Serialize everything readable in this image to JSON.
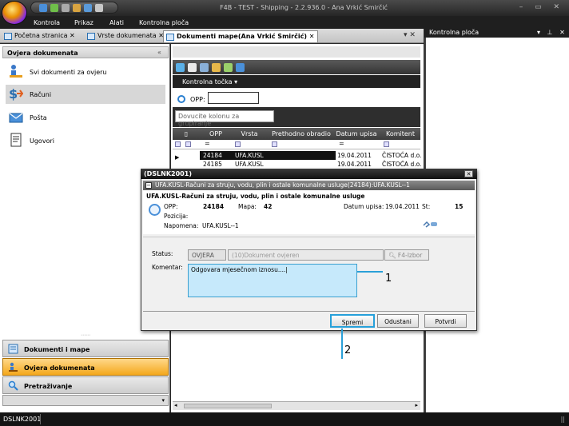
{
  "window": {
    "title": "F4B - TEST - Shipping - 2.2.936.0 - Ana  Vrkić Smirčić",
    "controls": "– ▭ ✕"
  },
  "menu": [
    "Kontrola",
    "Prikaz",
    "Alati",
    "Kontrolna ploča"
  ],
  "tabs": [
    {
      "label": "Početna stranica",
      "close": "✕"
    },
    {
      "label": "Vrste dokumenata",
      "close": "✕"
    },
    {
      "label": "Dokumenti mape(Ana Vrkić Smirčić)",
      "close": "✕"
    }
  ],
  "tab_controls": "▾ ✕",
  "right_panel": {
    "title": "Kontrolna ploča",
    "controls": "▾ ⊥ ✕"
  },
  "left_panel": {
    "title": "Ovjera dokumenata",
    "collapse": "«",
    "items": [
      {
        "label": "Svi dokumenti za ovjeru",
        "icon": "person-check-icon"
      },
      {
        "label": "Računi",
        "icon": "invoice-icon"
      },
      {
        "label": "Pošta",
        "icon": "mail-icon"
      },
      {
        "label": "Ugovori",
        "icon": "contract-icon"
      }
    ],
    "grip": "⋯⋯",
    "nav_buttons": [
      {
        "label": "Dokumenti i mape",
        "icon": "documents-icon"
      },
      {
        "label": "Ovjera dokumenata",
        "icon": "approval-icon"
      },
      {
        "label": "Pretraživanje",
        "icon": "search-icon"
      }
    ],
    "footer_arrow": "▾"
  },
  "document": {
    "kontrolna_tocka": "Kontrolna točka ▾",
    "opp_label": "OPP:",
    "opp_value": "",
    "group_hint": "Dovucite kolonu za grupiranje",
    "columns": [
      "OPP",
      "Vrsta",
      "Prethodno obradio",
      "Datum upisa",
      "Komitent"
    ],
    "filter_dash": "=",
    "rows": [
      {
        "opp": "24184",
        "vrsta": "UFA.KUSL",
        "prethodno": "",
        "datum": "19.04.2011",
        "komitent": "ČISTOĆA d.o."
      },
      {
        "opp": "24185",
        "vrsta": "UFA.KUSL",
        "prethodno": "",
        "datum": "19.04.2011",
        "komitent": "ČISTOĆA d.o."
      }
    ],
    "row_indicator": "▶",
    "hscroll": {
      "left": "◂",
      "right": "▸"
    }
  },
  "dialog": {
    "title": "(DSLNK2001)",
    "close": "✕",
    "group_header": "UFA.KUSL-Računi za struju, vodu, plin i ostale komunalne usluge(24184):UFA.KUSL--1",
    "group_toggle": "−",
    "info_title": "UFA.KUSL-Računi za struju, vodu, plin i ostale komunalne usluge",
    "opp_label": "OPP:",
    "opp_value": "24184",
    "mapa_label": "Mapa:",
    "mapa_value": "42",
    "datum_label": "Datum upisa:",
    "datum_value": "19.04.2011",
    "st_label": "St:",
    "st_value": "15",
    "pozicija_label": "Pozicija:",
    "napomena_label": "Napomena:",
    "napomena_value": "UFA.KUSL--1",
    "status_label": "Status:",
    "status_code": "OVJERA",
    "status_desc": "(10)Dokument ovjeren",
    "status_lookup": "F4-Izbor",
    "komentar_label": "Komentar:",
    "komentar_value": "Odgovara mjesečnom iznosu....|",
    "buttons": {
      "save": "Spremi",
      "cancel": "Odustani",
      "confirm": "Potvrdi"
    }
  },
  "callouts": [
    "1",
    "2"
  ],
  "statusbar": {
    "user": "DSLNK2001",
    "grip": "||"
  },
  "colors": {
    "accent_blue": "#26a0da",
    "active_nav": "#f4a81c",
    "komentar_bg": "#c6e9fb",
    "dark_chrome": "#1f1f1f"
  }
}
